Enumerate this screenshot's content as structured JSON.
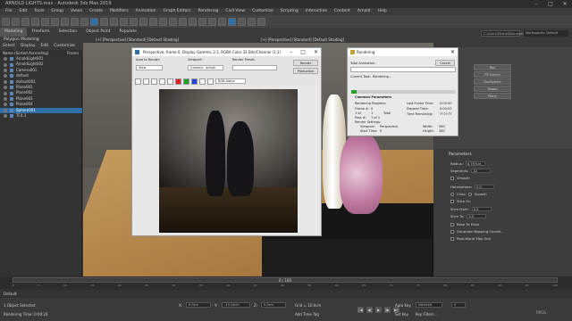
{
  "window": {
    "title": "ARNOLD LIGHTS.max - Autodesk 3ds Max 2019"
  },
  "menu": [
    "File",
    "Edit",
    "Tools",
    "Group",
    "Views",
    "Create",
    "Modifiers",
    "Animation",
    "Graph Editors",
    "Rendering",
    "Civil View",
    "Customize",
    "Scripting",
    "Interactive",
    "Content",
    "Arnold",
    "Help"
  ],
  "ribbon": {
    "tabs": [
      "Modeling",
      "Freeform",
      "Selection",
      "Object Paint",
      "Populate"
    ],
    "active": "Modeling",
    "subtitle": "Polygon Modeling"
  },
  "scene_explorer": {
    "tabs": [
      "Select",
      "Display",
      "Edit",
      "Customize"
    ],
    "header": "Name (Sorted Ascending)",
    "header_right": "Frozen",
    "items": [
      "ArnoldLight001",
      "ArnoldLight002",
      "Camera001",
      "default",
      "default001",
      "Plane001",
      "Plane002",
      "Plane003",
      "Plane004",
      "Sphere001",
      "TC4.1"
    ],
    "selected_index": 9
  },
  "viewport": {
    "label": "[+] [Perspective] [Standard] [Default Shading]",
    "label2": "[+] [Perspective] [Standard] [Default Shading]"
  },
  "frame_buffer": {
    "title": "Perspective, frame 0, Display Gamma: 2.2, RGBA Color 32 Bits/Channel (1:1)",
    "area_label": "Area to Render:",
    "area_value": "View",
    "viewport_label": "Viewport:",
    "viewport_value": "Camera - active",
    "preset_label": "Render Preset:",
    "preset_value": "",
    "render_button": "Render",
    "production_button": "Production",
    "channel_value": "RGB Alpha"
  },
  "rendering_dialog": {
    "title": "Rendering",
    "cancel": "Cancel",
    "total_animation": "Total Animation:",
    "current_task_label": "Current Task:",
    "current_task_value": "Rendering...",
    "common_params": "Common Parameters",
    "rendering_progress": "Rendering Progress:",
    "frame_label": "Frame #:",
    "frame_value": "0",
    "of_label": "1 of",
    "of_value": "1",
    "total_label": "Total",
    "pass_label": "Pass #:",
    "pass_value": "1 of 1",
    "last_frame_label": "Last Frame Time:",
    "last_frame_value": "0:00:00",
    "elapsed_label": "Elapsed Time:",
    "elapsed_value": "0:00:03",
    "remaining_label": "Time Remaining:",
    "remaining_value": "??:??:??",
    "progress": 0.05,
    "render_settings": "Render Settings:",
    "viewport_label": "Viewport:",
    "viewport_value": "Perspective",
    "width_label": "Width:",
    "width_value": "960",
    "start_label": "Start Time:",
    "start_value": "0",
    "height_label": "Height:",
    "height_value": "480"
  },
  "command_panel": {
    "workspace_field": "C:\\Users\\Shahid\\Documents\\3dsMax",
    "workspaces": "Workspaces: Default",
    "buttons": [
      "Box",
      "Cone",
      "Sphere",
      "GeoSphere",
      "Cylinder",
      "Tube",
      "Torus",
      "Pyramid",
      "Teapot",
      "Plane"
    ],
    "cmd_buttons": [
      "Box",
      "PF Source",
      "GeoSphere",
      "Teapot",
      "Plane"
    ],
    "params_title": "Parameters",
    "radius_label": "Radius:",
    "radius_value": "6.797cm",
    "segments_label": "Segments:",
    "segments_value": "32",
    "smooth_label": "Smooth",
    "hemisphere_label": "Hemisphere:",
    "hemisphere_value": "0.0",
    "chop_label": "Chop",
    "squash_label": "Squash",
    "slice_on_label": "Slice On",
    "slice_from_label": "Slice From:",
    "slice_from_value": "0.0",
    "slice_to_label": "Slice To:",
    "slice_to_value": "0.0",
    "base_to_pivot_label": "Base To Pivot",
    "gen_mapping_label": "Generate Mapping Coords.",
    "real_world_label": "Real-World Map Size"
  },
  "timeline": {
    "slider_text": "0 / 100",
    "ticks": [
      "0",
      "5",
      "10",
      "15",
      "20",
      "25",
      "30",
      "35",
      "40",
      "45",
      "50",
      "55",
      "60",
      "65",
      "70",
      "75",
      "80",
      "85",
      "90",
      "95",
      "100"
    ]
  },
  "layer": {
    "value": "Default"
  },
  "status": {
    "selected": "1 Object Selected",
    "rendering_time": "Rendering Time: 0:00:26",
    "x_label": "X:",
    "x_value": "0.0cm",
    "y_label": "Y:",
    "y_value": "-13.14cm",
    "z_label": "Z:",
    "z_value": "0.0cm",
    "grid": "Grid = 10.0cm",
    "auto_key": "Auto Key",
    "selected_key": "Selected",
    "set_key": "Set Key",
    "key_filters": "Key Filters...",
    "add_time_tag": "Add Time Tag",
    "frame_value": "0",
    "watermark": "RRCG"
  }
}
